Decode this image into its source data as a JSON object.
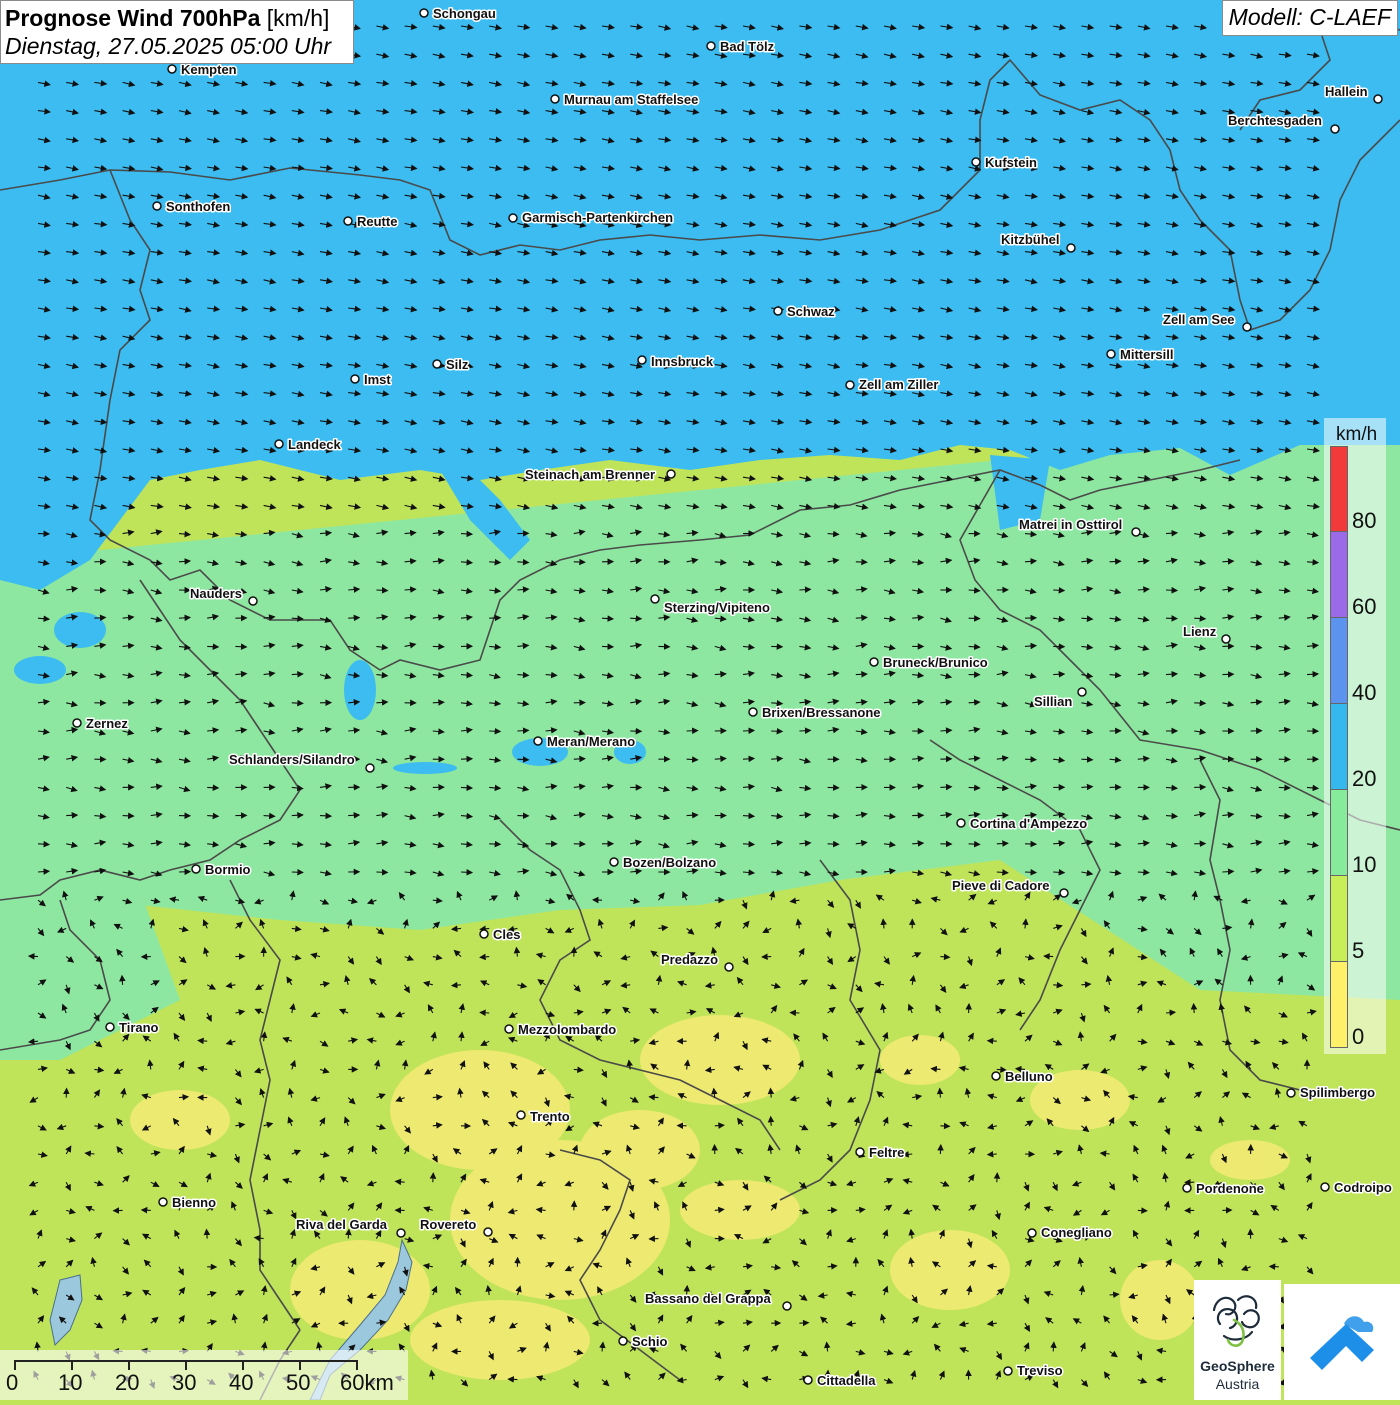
{
  "header": {
    "title_bold": "Prognose Wind 700hPa",
    "title_unit": "[km/h]",
    "datetime": "Dienstag, 27.05.2025 05:00 Uhr",
    "model": "Modell: C-LAEF"
  },
  "legend": {
    "unit": "km/h",
    "ticks": [
      "80",
      "60",
      "40",
      "20",
      "10",
      "5",
      "0"
    ],
    "colors": [
      "#f23a3a",
      "#9b6ae8",
      "#5b93ee",
      "#34b8ee",
      "#86eb9a",
      "#c8ee58",
      "#fff06a"
    ]
  },
  "scale_bar": {
    "labels": [
      "0",
      "10",
      "20",
      "30",
      "40",
      "50",
      "60km"
    ]
  },
  "logos": {
    "geosphere_name": "GeoSphere",
    "geosphere_sub": "Austria",
    "app_icon": "mountain-wind-app-icon"
  },
  "cities": [
    {
      "name": "Schongau"
    },
    {
      "name": "Bad Tölz"
    },
    {
      "name": "Kempten"
    },
    {
      "name": "Murnau am Staffelsee"
    },
    {
      "name": "Hallein"
    },
    {
      "name": "Berchtesgaden"
    },
    {
      "name": "Kufstein"
    },
    {
      "name": "Sonthofen"
    },
    {
      "name": "Reutte"
    },
    {
      "name": "Garmisch-Partenkirchen"
    },
    {
      "name": "Kitzbühel"
    },
    {
      "name": "Schwaz"
    },
    {
      "name": "Zell am See"
    },
    {
      "name": "Mittersill"
    },
    {
      "name": "Innsbruck"
    },
    {
      "name": "Silz"
    },
    {
      "name": "Imst"
    },
    {
      "name": "Zell am Ziller"
    },
    {
      "name": "Landeck"
    },
    {
      "name": "Steinach am Brenner"
    },
    {
      "name": "Matrei in Osttirol"
    },
    {
      "name": "Nauders"
    },
    {
      "name": "Sterzing/Vipiteno"
    },
    {
      "name": "Lienz"
    },
    {
      "name": "Bruneck/Brunico"
    },
    {
      "name": "Sillian"
    },
    {
      "name": "Zernez"
    },
    {
      "name": "Brixen/Bressanone"
    },
    {
      "name": "Meran/Merano"
    },
    {
      "name": "Schlanders/Silandro"
    },
    {
      "name": "Cortina d'Ampezzo"
    },
    {
      "name": "Bormio"
    },
    {
      "name": "Bozen/Bolzano"
    },
    {
      "name": "Pieve di Cadore"
    },
    {
      "name": "Cles"
    },
    {
      "name": "Predazzo"
    },
    {
      "name": "Tirano"
    },
    {
      "name": "Mezzolombardo"
    },
    {
      "name": "Belluno"
    },
    {
      "name": "Spilimbergo"
    },
    {
      "name": "Trento"
    },
    {
      "name": "Feltre"
    },
    {
      "name": "Pordenone"
    },
    {
      "name": "Codroipo"
    },
    {
      "name": "Bienno"
    },
    {
      "name": "Riva del Garda"
    },
    {
      "name": "Rovereto"
    },
    {
      "name": "Conegliano"
    },
    {
      "name": "Bassano del Grappa"
    },
    {
      "name": "Schio"
    },
    {
      "name": "Treviso"
    },
    {
      "name": "Cittadella"
    }
  ]
}
